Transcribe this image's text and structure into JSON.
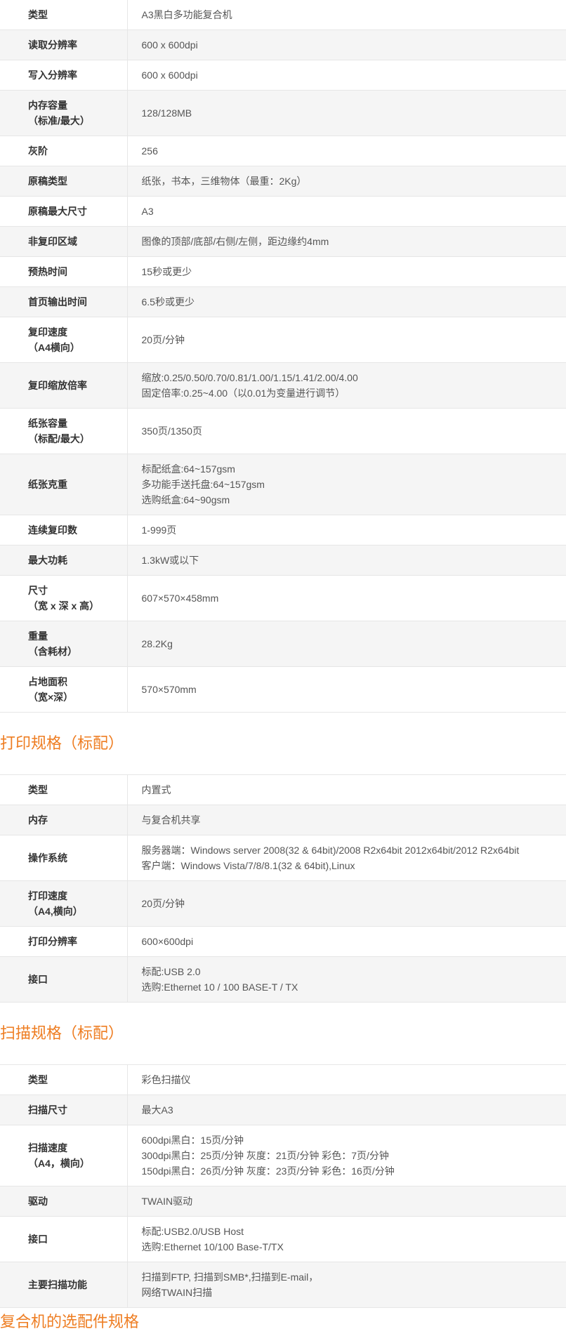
{
  "section1": {
    "rows": [
      {
        "label": [
          "类型"
        ],
        "value": [
          "A3黑白多功能复合机"
        ]
      },
      {
        "label": [
          "读取分辨率"
        ],
        "value": [
          "600 x 600dpi"
        ]
      },
      {
        "label": [
          "写入分辨率"
        ],
        "value": [
          "600 x 600dpi"
        ]
      },
      {
        "label": [
          "内存容量",
          "（标准/最大）"
        ],
        "value": [
          "128/128MB"
        ]
      },
      {
        "label": [
          "灰阶"
        ],
        "value": [
          "256"
        ]
      },
      {
        "label": [
          "原稿类型"
        ],
        "value": [
          "纸张，书本，三维物体（最重：2Kg）"
        ]
      },
      {
        "label": [
          "原稿最大尺寸"
        ],
        "value": [
          "A3"
        ]
      },
      {
        "label": [
          "非复印区域"
        ],
        "value": [
          "图像的顶部/底部/右侧/左侧，距边缘约4mm"
        ]
      },
      {
        "label": [
          "预热时间"
        ],
        "value": [
          "15秒或更少"
        ]
      },
      {
        "label": [
          "首页输出时间"
        ],
        "value": [
          "6.5秒或更少"
        ]
      },
      {
        "label": [
          "复印速度",
          "（A4横向）"
        ],
        "value": [
          "20页/分钟"
        ]
      },
      {
        "label": [
          "复印缩放倍率"
        ],
        "value": [
          "缩放:0.25/0.50/0.70/0.81/1.00/1.15/1.41/2.00/4.00",
          "固定倍率:0.25~4.00（以0.01为变量进行调节）"
        ]
      },
      {
        "label": [
          "纸张容量",
          "（标配/最大）"
        ],
        "value": [
          "350页/1350页"
        ]
      },
      {
        "label": [
          "纸张克重"
        ],
        "value": [
          "标配纸盒:64~157gsm",
          "多功能手送托盘:64~157gsm",
          "选购纸盒:64~90gsm"
        ]
      },
      {
        "label": [
          "连续复印数"
        ],
        "value": [
          "1-999页"
        ]
      },
      {
        "label": [
          "最大功耗"
        ],
        "value": [
          "1.3kW或以下"
        ]
      },
      {
        "label": [
          "尺寸",
          "（宽 x 深 x 高）"
        ],
        "value": [
          "607×570×458mm"
        ]
      },
      {
        "label": [
          "重量",
          "（含耗材）"
        ],
        "value": [
          "28.2Kg"
        ]
      },
      {
        "label": [
          "占地面积",
          "（宽×深）"
        ],
        "value": [
          "570×570mm"
        ]
      }
    ]
  },
  "section2": {
    "title": "打印规格（标配）",
    "rows": [
      {
        "label": [
          "类型"
        ],
        "value": [
          "内置式"
        ]
      },
      {
        "label": [
          "内存"
        ],
        "value": [
          "与复合机共享"
        ]
      },
      {
        "label": [
          "操作系统"
        ],
        "value": [
          "服务器端：Windows server 2008(32 & 64bit)/2008 R2x64bit 2012x64bit/2012 R2x64bit",
          "客户端：Windows Vista/7/8/8.1(32 & 64bit),Linux"
        ]
      },
      {
        "label": [
          "打印速度",
          "（A4,横向）"
        ],
        "value": [
          "20页/分钟"
        ]
      },
      {
        "label": [
          "打印分辨率"
        ],
        "value": [
          "600×600dpi"
        ]
      },
      {
        "label": [
          "接口"
        ],
        "value": [
          "标配:USB 2.0",
          "选购:Ethernet 10 / 100 BASE-T / TX"
        ]
      }
    ]
  },
  "section3": {
    "title": "扫描规格（标配）",
    "rows": [
      {
        "label": [
          "类型"
        ],
        "value": [
          "彩色扫描仪"
        ]
      },
      {
        "label": [
          "扫描尺寸"
        ],
        "value": [
          "最大A3"
        ]
      },
      {
        "label": [
          "扫描速度",
          "（A4，横向）"
        ],
        "value": [
          "600dpi黑白：15页/分钟",
          "300dpi黑白：25页/分钟 灰度：21页/分钟 彩色：7页/分钟",
          "150dpi黑白：26页/分钟 灰度：23页/分钟 彩色：16页/分钟"
        ]
      },
      {
        "label": [
          "驱动"
        ],
        "value": [
          "TWAIN驱动"
        ]
      },
      {
        "label": [
          "接口"
        ],
        "value": [
          "标配:USB2.0/USB Host",
          "选购:Ethernet 10/100 Base-T/TX"
        ]
      },
      {
        "label": [
          "主要扫描功能"
        ],
        "value": [
          "扫描到FTP, 扫描到SMB*,扫描到E-mail，",
          "网络TWAIN扫描"
        ]
      }
    ]
  },
  "section4": {
    "title": "复合机的选配件规格"
  }
}
